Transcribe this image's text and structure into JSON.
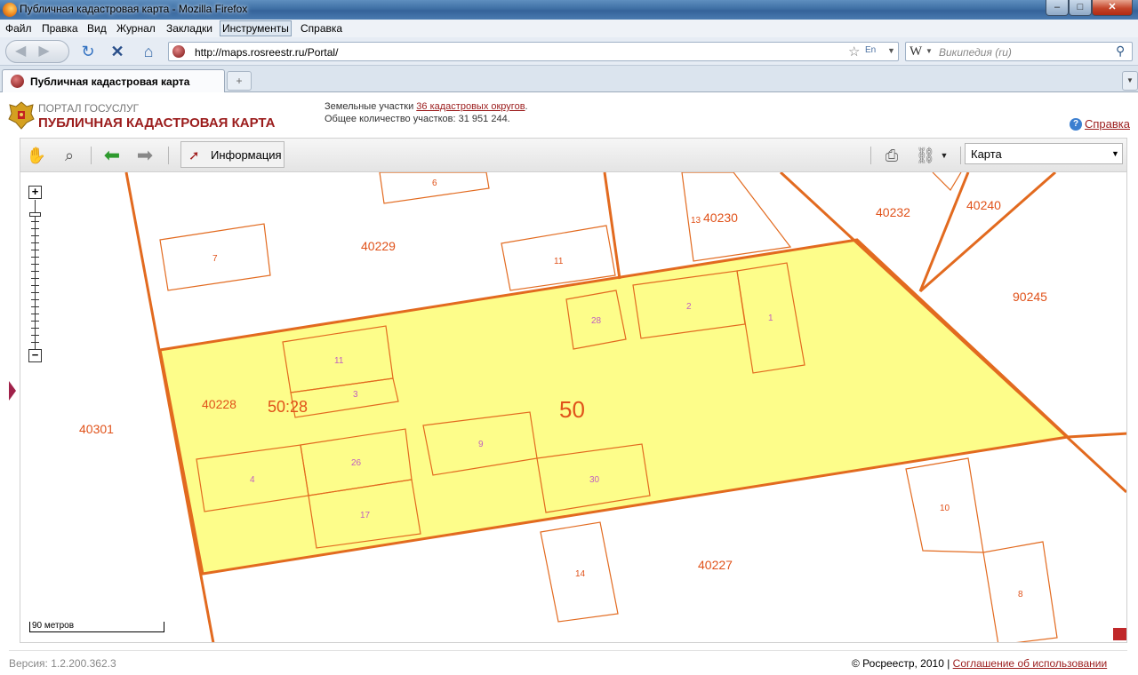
{
  "window": {
    "title": "Публичная кадастровая карта - Mozilla Firefox",
    "min_label": "–",
    "max_label": "□",
    "close_label": "✕"
  },
  "menu": [
    "Файл",
    "Правка",
    "Вид",
    "Журнал",
    "Закладки",
    "Инструменты",
    "Справка"
  ],
  "nav": {
    "url": "http://maps.rosreestr.ru/Portal/",
    "lang_badge": "En",
    "search_placeholder": "Википедия (ru)"
  },
  "tabs": [
    {
      "label": "Публичная кадастровая карта"
    }
  ],
  "header": {
    "portal": "ПОРТАЛ ГОСУСЛУГ",
    "title": "ПУБЛИЧНАЯ КАДАСТРОВАЯ КАРТА",
    "stats_prefix": "Земельные участки",
    "stats_link": "36 кадастровых округов",
    "stats_link_suffix": ".",
    "stats_total": "Общее количество участков: 31 951 244.",
    "help": "Справка"
  },
  "toolbar": {
    "info_label": "Информация",
    "layer_value": "Карта"
  },
  "map": {
    "block_label": "50",
    "block_code": "50:28",
    "quarters": [
      "40229",
      "40230",
      "40232",
      "40240",
      "90245",
      "40228",
      "40301",
      "40227"
    ],
    "parcels": [
      "6",
      "7",
      "11",
      "13",
      "28",
      "2",
      "1",
      "11",
      "3",
      "9",
      "30",
      "4",
      "26",
      "17",
      "10",
      "14",
      "8"
    ],
    "scale": "90 метров",
    "colors": {
      "boundary": "#e26a1f",
      "selected_fill": "#fdfd8a",
      "label": "#e0521a"
    }
  },
  "footer": {
    "version": "Версия: 1.2.200.362.3",
    "copyright": "© Росреестр, 2010 | ",
    "agreement": "Соглашение об использовании"
  }
}
